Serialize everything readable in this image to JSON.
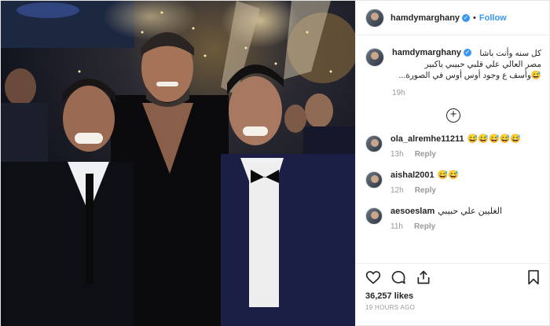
{
  "post": {
    "username": "hamdymarghany",
    "verified_icon": "verified-badge-icon",
    "follow_label": "Follow",
    "caption_lines": [
      "كل سنه وأنت باشا",
      "مصر العالي علي قلبي حبيبي ياكبير",
      "وأسف ع وجود أوس أوس في الصورة..."
    ],
    "caption_emoji": "😅",
    "caption_time": "19h",
    "likes": "36,257 likes",
    "time_ago": "19 HOURS AGO"
  },
  "comments": [
    {
      "username": "ola_alremhe11211",
      "text": "😅😅😅😅😅",
      "time": "13h",
      "reply": "Reply"
    },
    {
      "username": "aishal2001",
      "text": "😅😅",
      "time": "12h",
      "reply": "Reply"
    },
    {
      "username": "aesoeslam",
      "text": "الغليين علي حبيبي",
      "time": "11h",
      "reply": "Reply"
    }
  ],
  "icons": {
    "load_more": "plus-circle-icon",
    "like": "heart-icon",
    "comment": "comment-icon",
    "share": "share-icon",
    "save": "bookmark-icon"
  },
  "colors": {
    "accent": "#3897f0",
    "muted": "#999999",
    "text": "#262626"
  }
}
